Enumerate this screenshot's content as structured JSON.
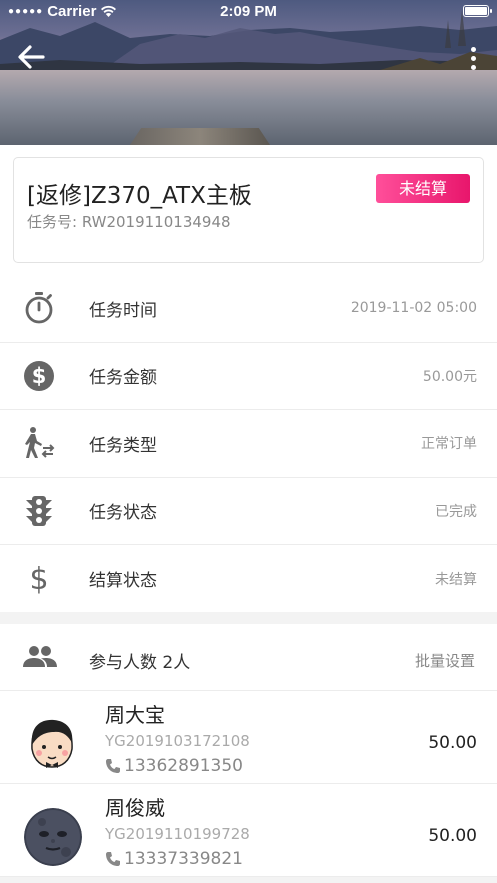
{
  "status_bar": {
    "carrier": "Carrier",
    "time": "2:09 PM"
  },
  "task": {
    "title": "[返修]Z370_ATX主板",
    "number": "任务号: RW2019110134948",
    "settle_badge": "未结算",
    "badge_color": "#ec1a6f"
  },
  "info_rows": [
    {
      "icon": "stopwatch-icon",
      "label": "任务时间",
      "value": "2019-11-02 05:00"
    },
    {
      "icon": "dollar-circle-icon",
      "label": "任务金额",
      "value": "50.00元"
    },
    {
      "icon": "pedestrian-swap-icon",
      "label": "任务类型",
      "value": "正常订单"
    },
    {
      "icon": "traffic-light-icon",
      "label": "任务状态",
      "value": "已完成"
    },
    {
      "icon": "dollar-icon",
      "label": "结算状态",
      "value": "未结算"
    }
  ],
  "participants": {
    "label": "参与人数 2人",
    "batch_action": "批量设置",
    "members": [
      {
        "name": "周大宝",
        "code": "YG2019103172108",
        "phone": "13362891350",
        "amount": "50.00",
        "avatar": "cartoon-face-avatar"
      },
      {
        "name": "周俊威",
        "code": "YG2019110199728",
        "phone": "13337339821",
        "amount": "50.00",
        "avatar": "moon-face-avatar"
      }
    ]
  }
}
